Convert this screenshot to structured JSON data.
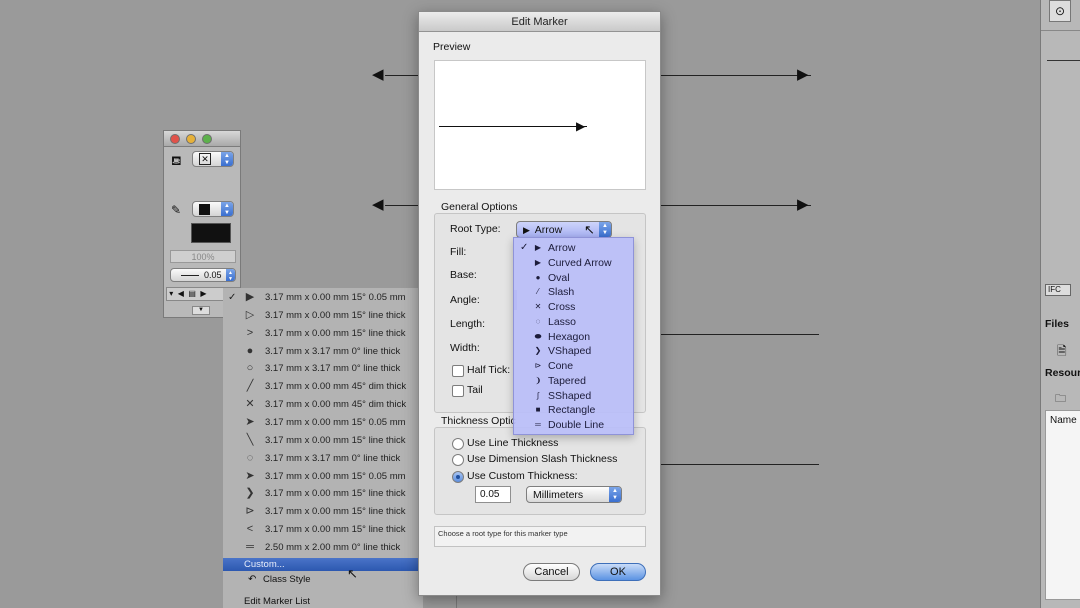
{
  "dialog": {
    "title": "Edit Marker",
    "preview_label": "Preview",
    "general_options_label": "General Options",
    "root_type_label": "Root Type:",
    "root_type_value": "Arrow",
    "fill_label": "Fill:",
    "base_label": "Base:",
    "angle_label": "Angle:",
    "length_label": "Length:",
    "width_label": "Width:",
    "half_tick_label": "Half Tick:",
    "tail_label": "Tail",
    "thickness_options_label": "Thickness Optic",
    "thickness_radios": [
      {
        "label": "Use Line Thickness",
        "selected": false
      },
      {
        "label": "Use Dimension Slash Thickness",
        "selected": false
      },
      {
        "label": "Use Custom Thickness:",
        "selected": true
      }
    ],
    "custom_thickness_value": "0.05",
    "units_value": "Millimeters",
    "help_text": "Choose a root type for this marker type",
    "cancel_label": "Cancel",
    "ok_label": "OK"
  },
  "root_type_menu": {
    "items": [
      {
        "label": "Arrow",
        "icon": "▶",
        "checked": true
      },
      {
        "label": "Curved Arrow",
        "icon": "▶",
        "checked": false
      },
      {
        "label": "Oval",
        "icon": "●",
        "checked": false
      },
      {
        "label": "Slash",
        "icon": "⁄",
        "checked": false
      },
      {
        "label": "Cross",
        "icon": "✕",
        "checked": false
      },
      {
        "label": "Lasso",
        "icon": "◌",
        "checked": false
      },
      {
        "label": "Hexagon",
        "icon": "⬬",
        "checked": false
      },
      {
        "label": "VShaped",
        "icon": "❯",
        "checked": false
      },
      {
        "label": "Cone",
        "icon": "⊳",
        "checked": false
      },
      {
        "label": "Tapered",
        "icon": "❩",
        "checked": false
      },
      {
        "label": "SShaped",
        "icon": "∫",
        "checked": false
      },
      {
        "label": "Rectangle",
        "icon": "■",
        "checked": false
      },
      {
        "label": "Double Line",
        "icon": "═",
        "checked": false
      }
    ]
  },
  "marker_list": {
    "items": [
      {
        "icon": "▶",
        "text": "3.17 mm x 0.00 mm 15°  0.05 mm",
        "checked": true
      },
      {
        "icon": "▷",
        "text": "3.17 mm x 0.00 mm 15°  line thick",
        "checked": false
      },
      {
        "icon": ">",
        "text": "3.17 mm x 0.00 mm 15°  line thick",
        "checked": false
      },
      {
        "icon": "●",
        "text": "3.17 mm x 3.17 mm   0°  line thick",
        "checked": false
      },
      {
        "icon": "○",
        "text": "3.17 mm x 3.17 mm   0°  line thick",
        "checked": false
      },
      {
        "icon": "╱",
        "text": "3.17 mm x 0.00 mm 45°  dim thick",
        "checked": false
      },
      {
        "icon": "✕",
        "text": "3.17 mm x 0.00 mm 45°  dim thick",
        "checked": false
      },
      {
        "icon": "➤",
        "text": "3.17 mm x 0.00 mm 15°  0.05 mm",
        "checked": false
      },
      {
        "icon": "╲",
        "text": "3.17 mm x 0.00 mm 15°  line thick",
        "checked": false
      },
      {
        "icon": "◌",
        "text": "3.17 mm x 3.17 mm   0°  line thick",
        "checked": false
      },
      {
        "icon": "➤",
        "text": "3.17 mm x 0.00 mm 15°  0.05 mm",
        "checked": false
      },
      {
        "icon": "❯",
        "text": "3.17 mm x 0.00 mm 15°  line thick",
        "checked": false
      },
      {
        "icon": "⊳",
        "text": "3.17 mm x 0.00 mm 15°  line thick",
        "checked": false
      },
      {
        "icon": "<",
        "text": "3.17 mm x 0.00 mm 15°  line thick",
        "checked": false
      },
      {
        "icon": "═",
        "text": "2.50 mm x 2.00 mm   0°  line thick",
        "checked": false
      }
    ],
    "custom_label": "Custom...",
    "class_style_label": "Class Style",
    "edit_marker_list_label": "Edit Marker List"
  },
  "palette": {
    "opacity_value": "100%",
    "line_thickness_value": "0.05"
  },
  "right_panel": {
    "ifc_label": "IFC",
    "files_label": "Files",
    "resources_label": "Resour",
    "name_label": "Name"
  },
  "colors": {
    "menu_highlight": "#baBEF8",
    "selection_blue": "#2c58b0",
    "default_button": "#5b93e3"
  }
}
